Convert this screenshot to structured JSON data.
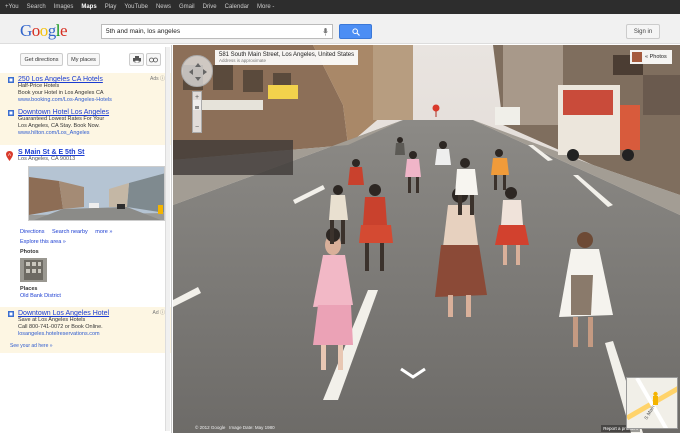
{
  "gbar": {
    "items": [
      "+You",
      "Search",
      "Images",
      "Maps",
      "Play",
      "YouTube",
      "News",
      "Gmail",
      "Drive",
      "Calendar",
      "More -"
    ],
    "active_index": 3
  },
  "header": {
    "logo_letters": [
      "G",
      "o",
      "o",
      "g",
      "l",
      "e"
    ],
    "search_value": "5th and main, los angeles",
    "signin_label": "Sign in"
  },
  "left": {
    "get_directions": "Get directions",
    "my_places": "My places",
    "ads_top": {
      "label": "Ads",
      "entries": [
        {
          "title": "250 Los Angeles CA Hotels",
          "lines": [
            "Half-Price Hotels",
            "Book your Hotel in Los Angeles CA"
          ],
          "url": "www.booking.com/Los-Angeles-Hotels"
        },
        {
          "title": "Downtown Hotel Los Angeles",
          "lines": [
            "Guaranteed Lowest Rates For Your",
            "Los Angeles, CA Stay. Book Now."
          ],
          "url": "www.hilton.com/Los_Angeles"
        }
      ]
    },
    "place": {
      "marker": "A",
      "title": "S Main St & E 5th St",
      "address": "Los Angeles, CA 90013"
    },
    "links": [
      "Directions",
      "Search nearby",
      "more »"
    ],
    "explore": "Explore this area »",
    "photos_label": "Photos",
    "places_label": "Places",
    "places_link": "Old Bank District",
    "ad_bottom": {
      "label": "Ad",
      "title": "Downtown Los Angeles Hotel",
      "lines": [
        "Save at Los Angeles Hotels",
        "Call 800-741-0072 or Book Online."
      ],
      "url": "losangeles.hotelreservations.com",
      "see_ad": "See your ad here »"
    }
  },
  "streetview": {
    "address_main": "581 South Main Street, Los Angeles, United States",
    "address_sub": "Address is approximate",
    "photos_label": "« Photos",
    "copyright": "© 2012 Google",
    "image_date": "Image Date: May 1980",
    "report": "Report a problem",
    "minimap_label": "S Main"
  }
}
